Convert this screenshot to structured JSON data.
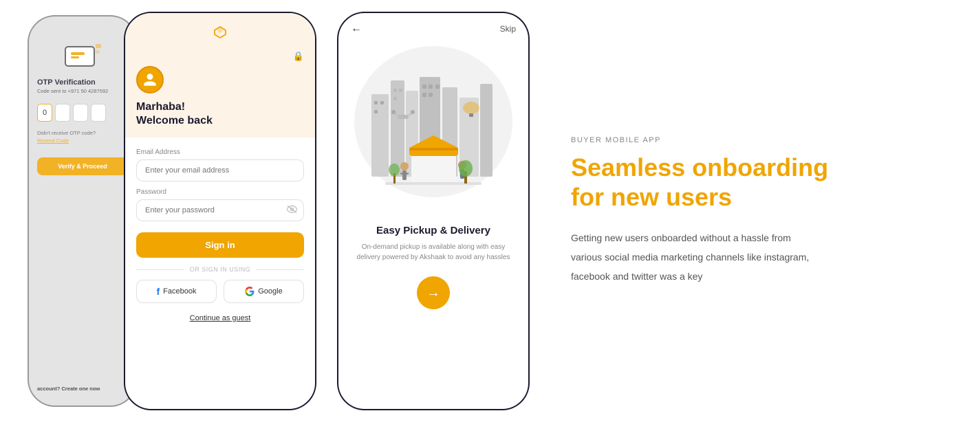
{
  "phone1": {
    "otp_title": "OTP Verification",
    "otp_subtitle": "Code sent to +971 50 4287592",
    "otp_values": [
      "0",
      "",
      "",
      ""
    ],
    "resend_question": "Didn't receive OTP code?",
    "resend_label": "Resend Code",
    "verify_btn": "Verify & Proceed",
    "no_account": "account?",
    "create_now": "Create one now"
  },
  "phone2": {
    "gem_icon": "◇",
    "lock_icon": "🔒",
    "welcome_line1": "Marhaba!",
    "welcome_line2": "Welcome back",
    "email_label": "Email Address",
    "email_placeholder": "Enter your email address",
    "password_label": "Password",
    "password_placeholder": "Enter your password",
    "signin_btn": "Sign in",
    "or_text": "OR SIGN IN USING",
    "facebook_label": "Facebook",
    "google_label": "Google",
    "guest_link": "Continue as guest"
  },
  "phone3": {
    "back_icon": "←",
    "skip_label": "Skip",
    "feature_title": "Easy Pickup & Delivery",
    "feature_desc": "On-demand pickup is available along with easy delivery powered by Akshaak to avoid any hassles",
    "next_icon": "→"
  },
  "right": {
    "buyer_label": "BUYER MOBILE APP",
    "heading_line1": "Seamless onboarding",
    "heading_line2": "for new users",
    "description": "Getting new users onboarded without a hassle from various social media marketing channels like instagram, facebook and twitter was a key"
  }
}
